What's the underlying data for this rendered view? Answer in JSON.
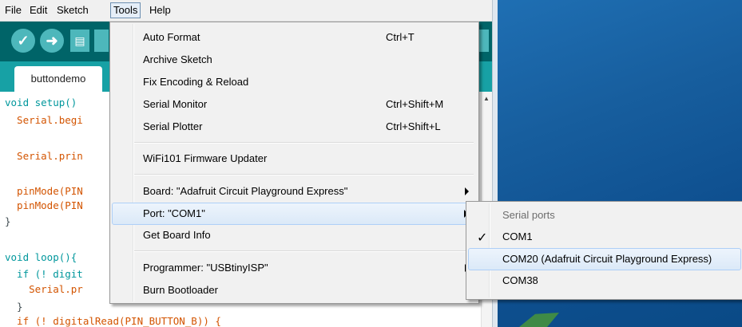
{
  "menubar": {
    "items": [
      "File",
      "Edit",
      "Sketch",
      "Tools",
      "Help"
    ]
  },
  "toolbar": {
    "verify_icon": "check-icon",
    "upload_icon": "arrow-right-icon",
    "new_icon": "document-icon"
  },
  "tab": {
    "label": "buttondemo"
  },
  "editor": {
    "lines": [
      "void setup()",
      "  Serial.begi",
      "",
      "  Serial.prin",
      "",
      "  pinMode(PIN",
      "  pinMode(PIN",
      "}",
      "",
      "void loop(){",
      "  if (! digit",
      "    Serial.pr",
      "  }",
      "  if (! digitalRead(PIN_BUTTON_B)) {"
    ]
  },
  "tools_menu": {
    "auto_format": "Auto Format",
    "auto_format_shortcut": "Ctrl+T",
    "archive_sketch": "Archive Sketch",
    "fix_encoding": "Fix Encoding & Reload",
    "serial_monitor": "Serial Monitor",
    "serial_monitor_shortcut": "Ctrl+Shift+M",
    "serial_plotter": "Serial Plotter",
    "serial_plotter_shortcut": "Ctrl+Shift+L",
    "wifi_updater": "WiFi101 Firmware Updater",
    "board": "Board: \"Adafruit Circuit Playground Express\"",
    "port": "Port: \"COM1\"",
    "get_board_info": "Get Board Info",
    "programmer": "Programmer: \"USBtinyISP\"",
    "burn_bootloader": "Burn Bootloader"
  },
  "port_menu": {
    "header": "Serial ports",
    "items": [
      "COM1",
      "COM20 (Adafruit Circuit Playground Express)",
      "COM38"
    ],
    "checked": "COM1",
    "check_glyph": "✓"
  },
  "colors": {
    "toolbar": "#006468",
    "tabs_bar": "#17a1a5",
    "button": "#4db7bb",
    "highlight": "#dbe9f8"
  }
}
